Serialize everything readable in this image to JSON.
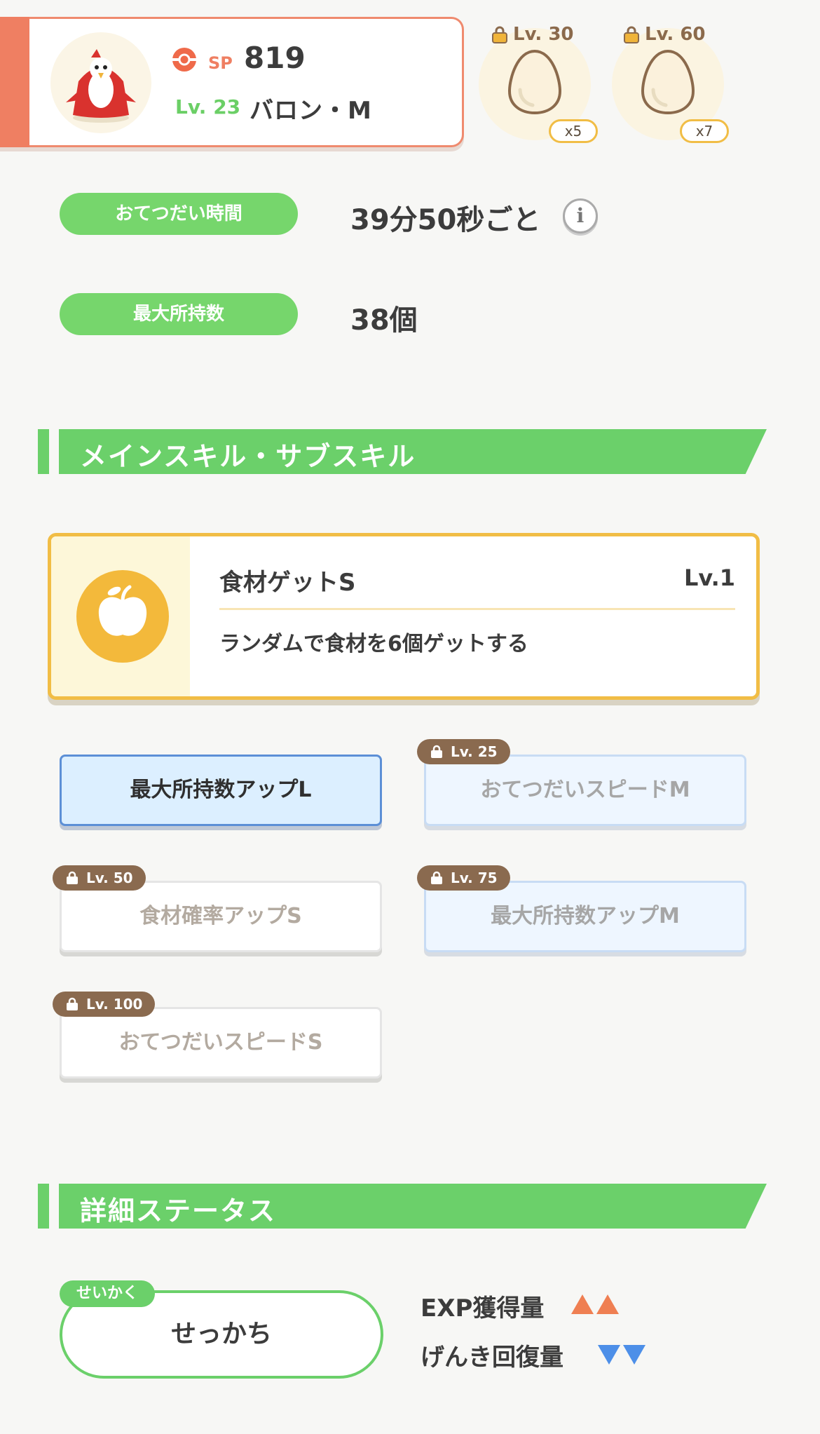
{
  "profile": {
    "sp_label": "SP",
    "sp_value": "819",
    "level_label": "Lv. 23",
    "pokemon_name": "バロン・M"
  },
  "eggs": [
    {
      "unlock_level": "Lv. 30",
      "count": "x5"
    },
    {
      "unlock_level": "Lv. 60",
      "count": "x7"
    }
  ],
  "info": {
    "help_time_label": "おてつだい時間",
    "help_time_value": "39分50秒ごと",
    "max_carry_label": "最大所持数",
    "max_carry_value": "38個",
    "info_icon": "i"
  },
  "skills_section": {
    "title": "メインスキル・サブスキル",
    "main_skill": {
      "name": "食材ゲットS",
      "level": "Lv.1",
      "description": "ランダムで食材を6個ゲットする",
      "icon": "apple-icon"
    },
    "sub_skills": [
      {
        "label": "最大所持数アップL",
        "unlock_level": "",
        "state": "active"
      },
      {
        "label": "おてつだいスピードM",
        "unlock_level": "Lv. 25",
        "state": "locked-blue"
      },
      {
        "label": "食材確率アップS",
        "unlock_level": "Lv. 50",
        "state": "locked-white"
      },
      {
        "label": "最大所持数アップM",
        "unlock_level": "Lv. 75",
        "state": "locked-blue"
      },
      {
        "label": "おてつだいスピードS",
        "unlock_level": "Lv. 100",
        "state": "locked-white"
      }
    ]
  },
  "status_section": {
    "title": "詳細ステータス",
    "nature_tag": "せいかく",
    "nature_value": "せっかち",
    "stats": [
      {
        "label": "EXP獲得量",
        "direction": "up"
      },
      {
        "label": "げんき回復量",
        "direction": "down"
      }
    ]
  },
  "colors": {
    "accent_green": "#6bd06a",
    "profile_orange": "#ef7f62",
    "skill_gold": "#f1bd45",
    "up_arrow": "#ef7f52",
    "down_arrow": "#4d8fe8"
  }
}
